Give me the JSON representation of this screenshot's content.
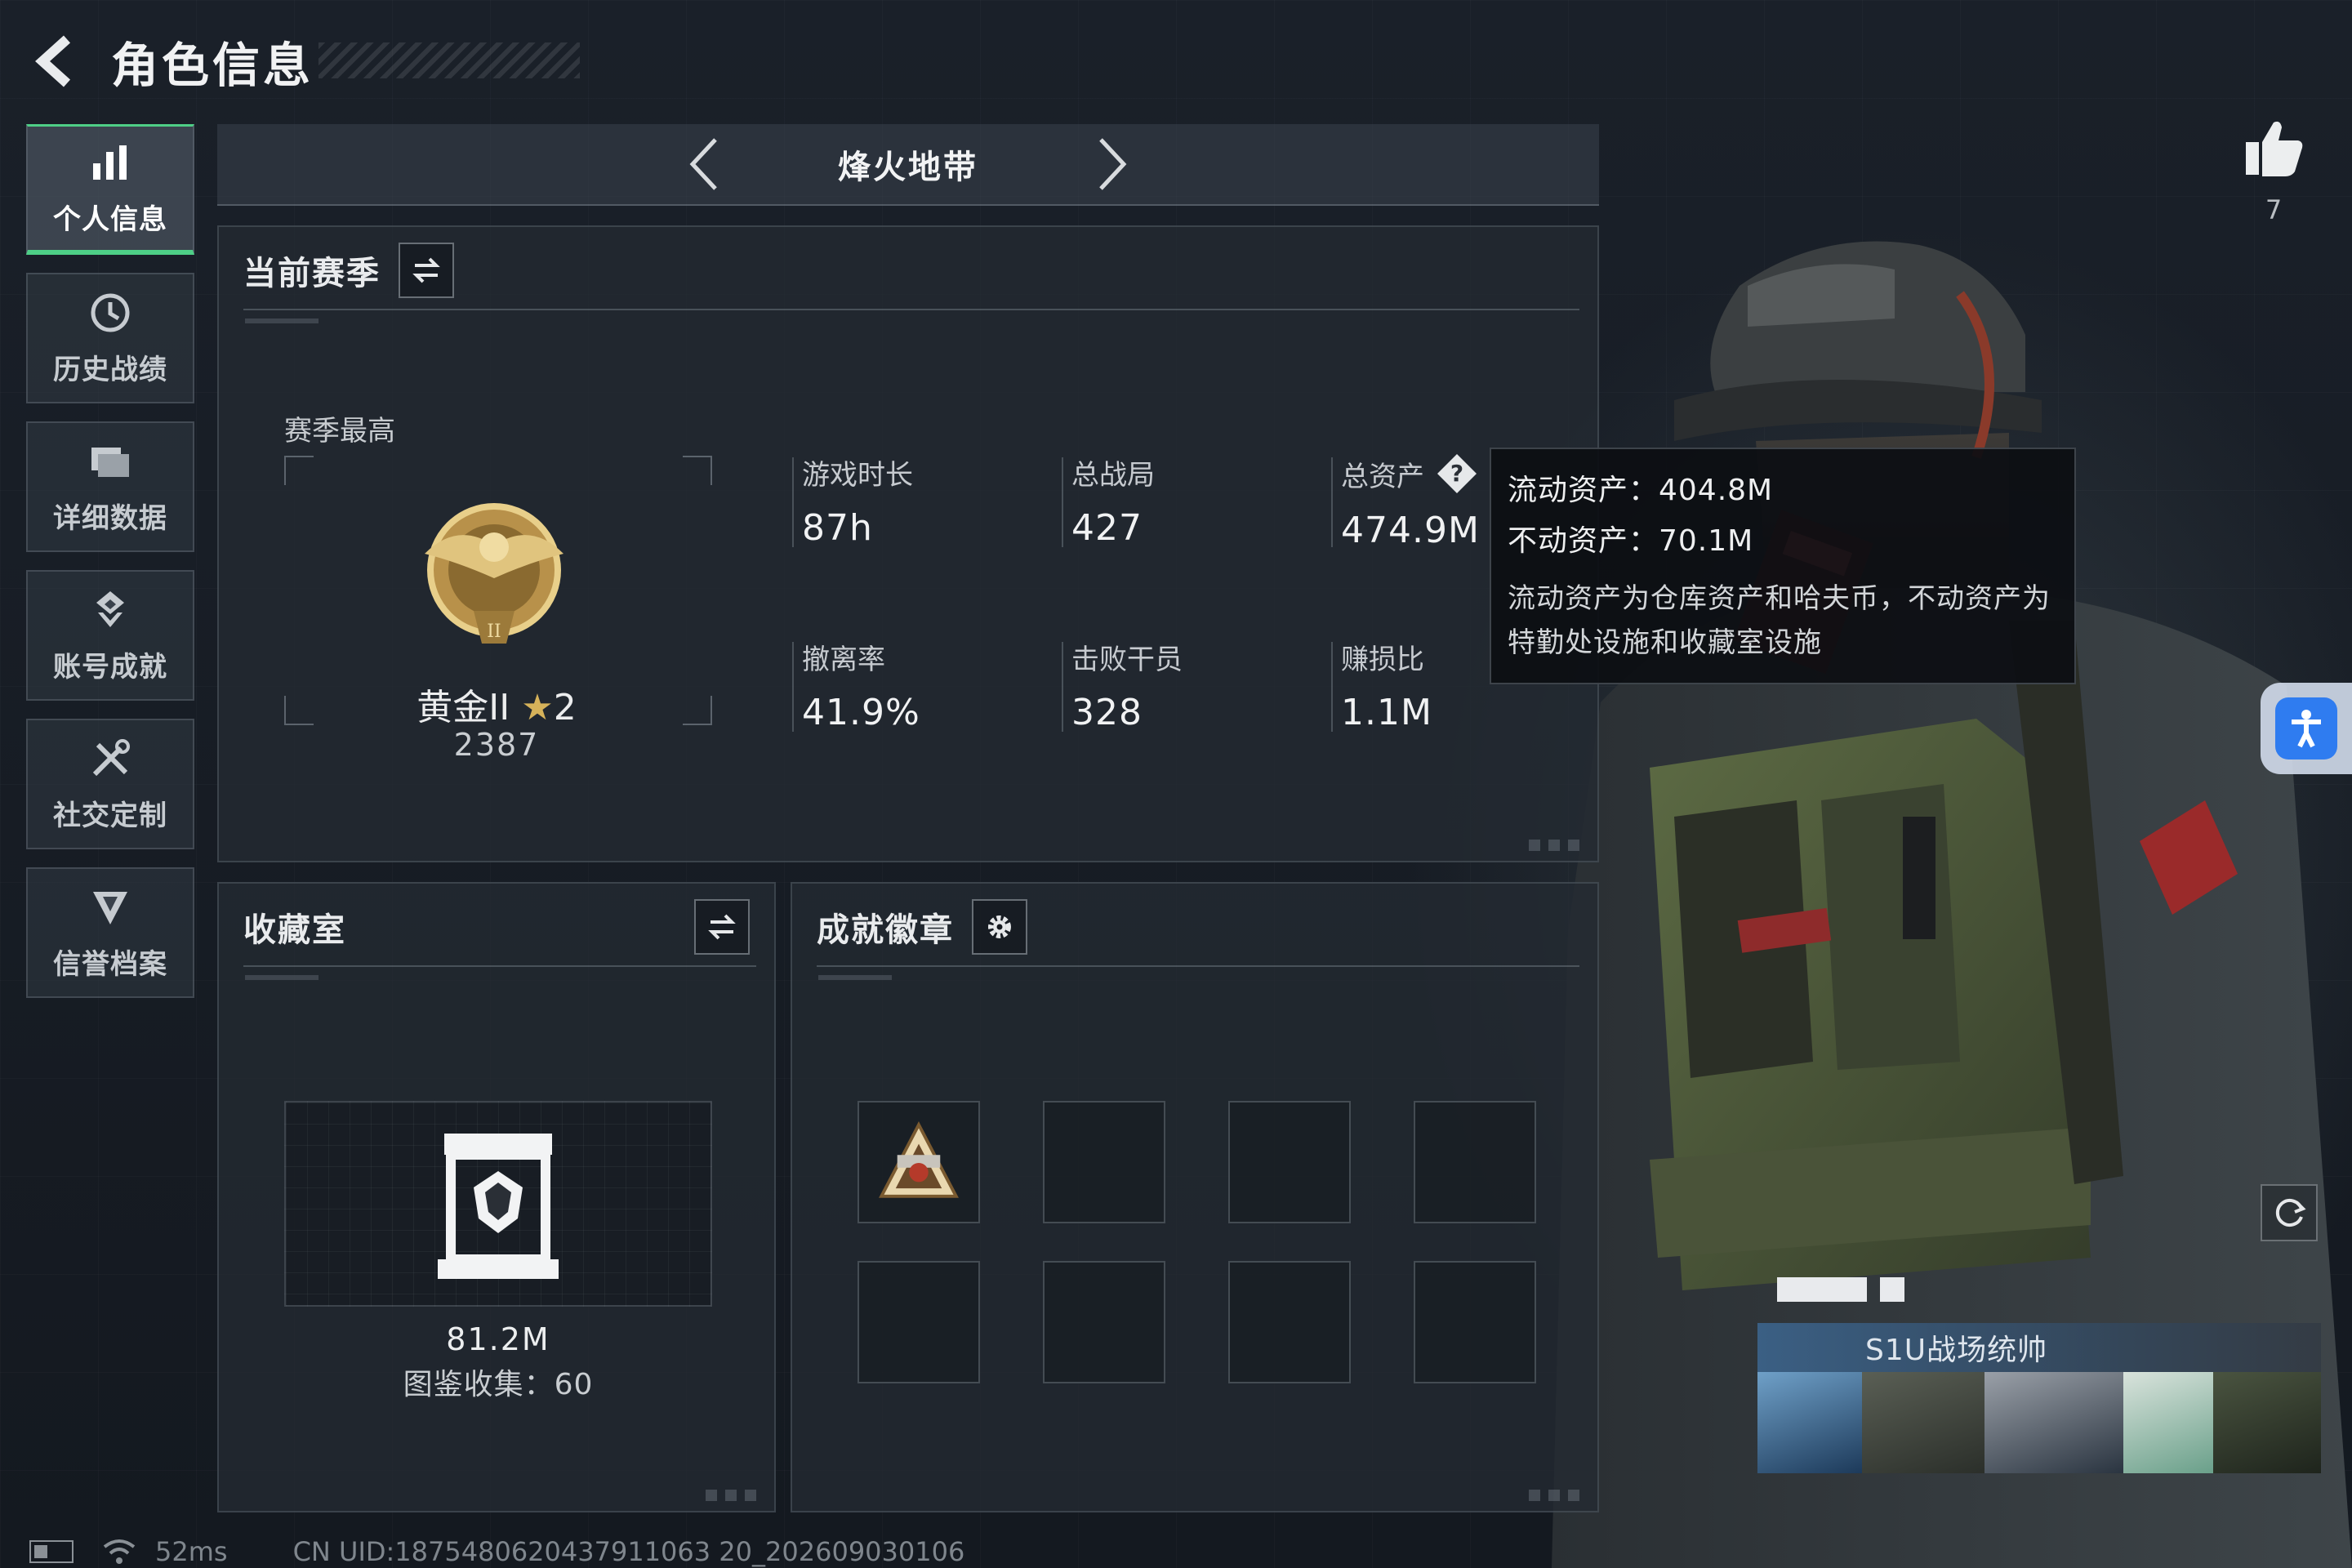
{
  "header": {
    "title": "角色信息"
  },
  "sidebar": {
    "items": [
      {
        "label": "个人信息",
        "icon": "bar-chart-icon",
        "active": true
      },
      {
        "label": "历史战绩",
        "icon": "clock-icon",
        "active": false
      },
      {
        "label": "详细数据",
        "icon": "folder-icon",
        "active": false
      },
      {
        "label": "账号成就",
        "icon": "badge-icon",
        "active": false
      },
      {
        "label": "社交定制",
        "icon": "tools-icon",
        "active": false
      },
      {
        "label": "信誉档案",
        "icon": "shield-icon",
        "active": false
      }
    ]
  },
  "mode": {
    "title": "烽火地带"
  },
  "season": {
    "title": "当前赛季",
    "best_label": "赛季最高",
    "rank_name": "黄金II",
    "rank_stars": "2",
    "rank_score": "2387",
    "stats": [
      {
        "label": "游戏时长",
        "value": "87h"
      },
      {
        "label": "总战局",
        "value": "427"
      },
      {
        "label": "总资产",
        "value": "474.9M"
      },
      {
        "label": "撤离率",
        "value": "41.9%"
      },
      {
        "label": "击败干员",
        "value": "328"
      },
      {
        "label": "赚损比",
        "value": "1.1M"
      }
    ]
  },
  "tooltip": {
    "liquid": "流动资产：404.8M",
    "fixed": "不动资产：70.1M",
    "description": "流动资产为仓库资产和哈夫币，不动资产为特勤处设施和收藏室设施"
  },
  "collection": {
    "title": "收藏室",
    "value": "81.2M",
    "count": "图鉴收集：60"
  },
  "achievements": {
    "title": "成就徽章"
  },
  "likes": {
    "count": "7"
  },
  "card": {
    "name": "S1U战场统帅"
  },
  "status_bar": {
    "ping": "52ms",
    "uid": "CN UID:1875480620437911063 20_202609030106"
  },
  "colors": {
    "accent": "#4ecf87",
    "gold": "#d6b25a",
    "access_blue": "#2f7cf0"
  }
}
